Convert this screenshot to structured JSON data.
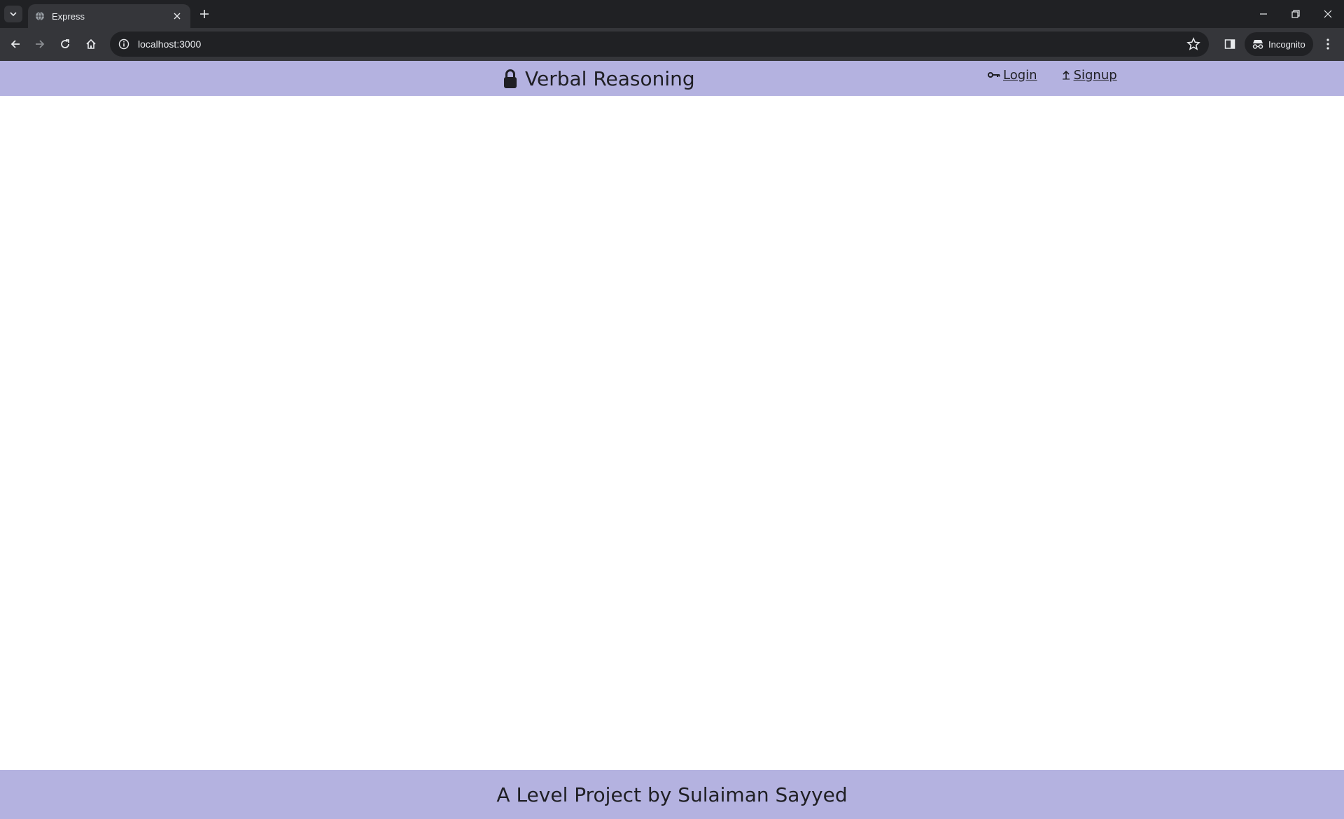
{
  "browser": {
    "tab_title": "Express",
    "url": "localhost:3000",
    "incognito_label": "Incognito"
  },
  "site": {
    "brand_title": "Verbal Reasoning",
    "nav": {
      "login_label": "Login",
      "signup_label": "Signup"
    },
    "footer_text": "A Level Project by Sulaiman Sayyed",
    "colors": {
      "header_bg": "#b4b2e0",
      "footer_bg": "#b4b2e0",
      "text": "#1f1f24"
    }
  }
}
